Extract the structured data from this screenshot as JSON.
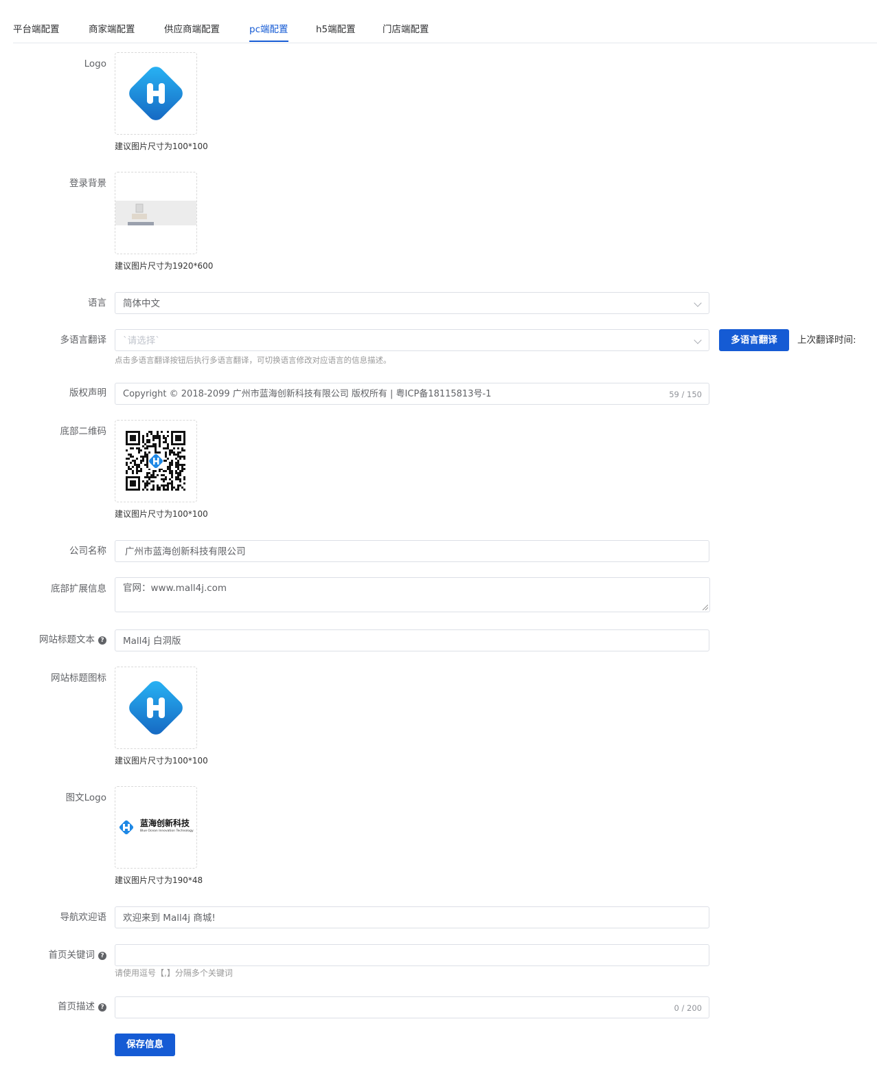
{
  "tabs": [
    {
      "label": "平台端配置",
      "active": false
    },
    {
      "label": "商家端配置",
      "active": false
    },
    {
      "label": "供应商端配置",
      "active": false
    },
    {
      "label": "pc端配置",
      "active": true
    },
    {
      "label": "h5端配置",
      "active": false
    },
    {
      "label": "门店端配置",
      "active": false
    }
  ],
  "form": {
    "logo": {
      "label": "Logo",
      "hint": "建议图片尺寸为100*100"
    },
    "login_bg": {
      "label": "登录背景",
      "hint": "建议图片尺寸为1920*600"
    },
    "language": {
      "label": "语言",
      "value": "简体中文"
    },
    "multi_lang": {
      "label": "多语言翻译",
      "placeholder": "`请选择`",
      "button": "多语言翻译",
      "last_time_label": "上次翻译时间:",
      "hint": "点击多语言翻译按钮后执行多语言翻译，可切换语言修改对应语言的信息描述。"
    },
    "copyright": {
      "label": "版权声明",
      "value": "Copyright © 2018-2099 广州市蓝海创新科技有限公司 版权所有 | 粤ICP备18115813号-1",
      "count": "59 / 150"
    },
    "qrcode": {
      "label": "底部二维码",
      "hint": "建议图片尺寸为100*100"
    },
    "company": {
      "label": "公司名称",
      "value": "广州市蓝海创新科技有限公司"
    },
    "footer_ext": {
      "label": "底部扩展信息",
      "value": "官网：www.mall4j.com"
    },
    "site_title": {
      "label": "网站标题文本",
      "value": "Mall4j 白洞版"
    },
    "site_icon": {
      "label": "网站标题图标",
      "hint": "建议图片尺寸为100*100"
    },
    "text_logo": {
      "label": "图文Logo",
      "hint": "建议图片尺寸为190*48",
      "brand_cn": "蓝海创新科技",
      "brand_en": "Blue Ocean Innovation Technology"
    },
    "nav_welcome": {
      "label": "导航欢迎语",
      "value": "欢迎来到 Mall4j 商城!"
    },
    "keywords": {
      "label": "首页关键词",
      "value": "",
      "hint": "请使用逗号【,】分隔多个关键词"
    },
    "description": {
      "label": "首页描述",
      "value": "",
      "count": "0 / 200"
    },
    "save_button": "保存信息"
  },
  "colors": {
    "primary": "#155bd4",
    "logo_blue": "#1e88e5",
    "logo_light": "#29b6f6"
  },
  "icons": [
    "help-icon",
    "chevron-down-icon"
  ]
}
